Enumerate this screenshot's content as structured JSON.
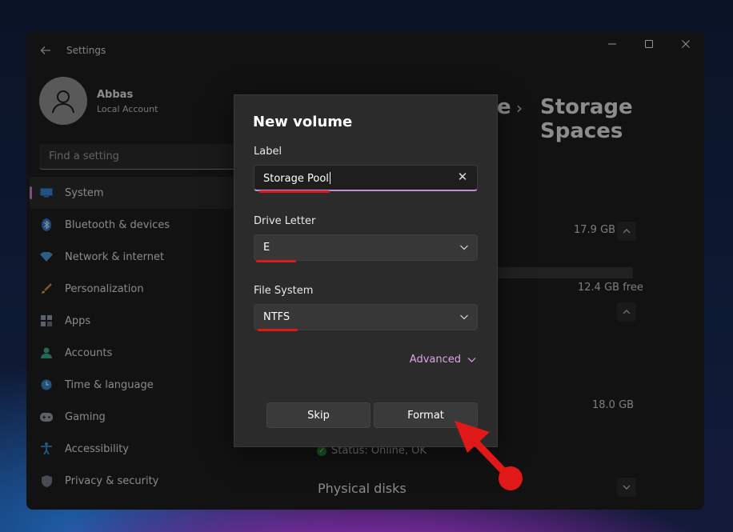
{
  "window": {
    "title": "Settings",
    "controls": [
      "minimize-icon",
      "maximize-icon",
      "close-icon"
    ]
  },
  "user": {
    "name": "Abbas",
    "account_type": "Local Account"
  },
  "search": {
    "placeholder": "Find a setting"
  },
  "sidebar": {
    "items": [
      {
        "label": "System",
        "icon": "monitor-icon",
        "selected": true
      },
      {
        "label": "Bluetooth & devices",
        "icon": "bluetooth-icon"
      },
      {
        "label": "Network & internet",
        "icon": "wifi-icon"
      },
      {
        "label": "Personalization",
        "icon": "brush-icon"
      },
      {
        "label": "Apps",
        "icon": "apps-icon"
      },
      {
        "label": "Accounts",
        "icon": "person-icon"
      },
      {
        "label": "Time & language",
        "icon": "globe-clock-icon"
      },
      {
        "label": "Gaming",
        "icon": "gamepad-icon"
      },
      {
        "label": "Accessibility",
        "icon": "accessibility-icon"
      },
      {
        "label": "Privacy & security",
        "icon": "shield-icon"
      }
    ]
  },
  "breadcrumb": {
    "partial": "e",
    "current": "Storage Spaces"
  },
  "background_content": {
    "pool_size": "17.9 GB",
    "free_space": "12.4 GB free",
    "space_size": "18.0 GB",
    "status": "Status: Online, OK",
    "physical_disks": "Physical disks"
  },
  "dialog": {
    "title": "New volume",
    "label_field": {
      "label": "Label",
      "value": "Storage Pool"
    },
    "drive_letter": {
      "label": "Drive Letter",
      "value": "E"
    },
    "file_system": {
      "label": "File System",
      "value": "NTFS"
    },
    "advanced_label": "Advanced",
    "skip_label": "Skip",
    "format_label": "Format"
  },
  "colors": {
    "accent": "#c98ad8",
    "annotation": "#e01818",
    "window_bg": "#202020",
    "dialog_bg": "#2b2b2b"
  }
}
